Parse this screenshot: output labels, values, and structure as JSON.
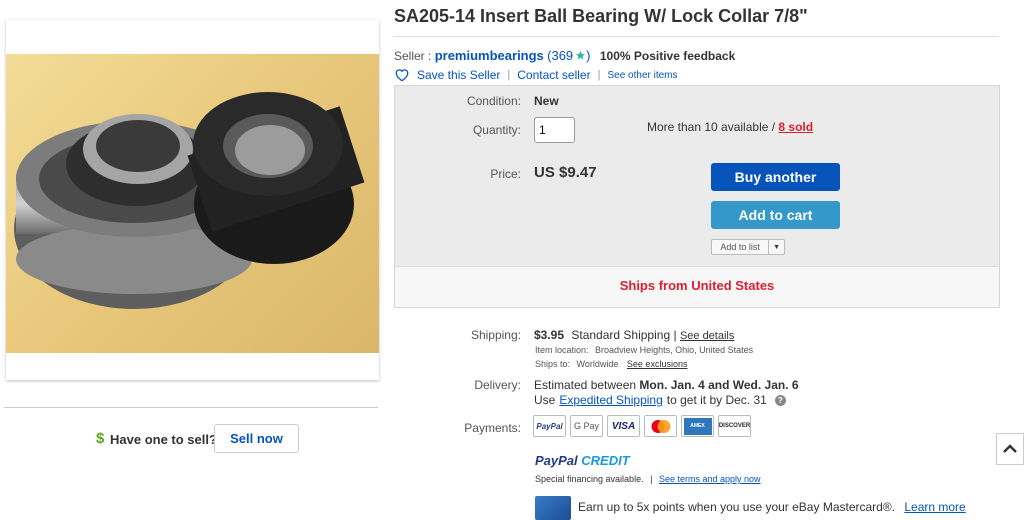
{
  "listing": {
    "title": "SA205-14 Insert Ball Bearing W/ Lock Collar 7/8\""
  },
  "seller": {
    "label": "Seller :",
    "name": "premiumbearings",
    "score_open": "(369",
    "score_close": ")",
    "feedback": "100% Positive feedback",
    "save_label": "Save this Seller",
    "contact_label": "Contact seller",
    "other_items_label": "See other items"
  },
  "purchase": {
    "condition_label": "Condition:",
    "condition_value": "New",
    "quantity_label": "Quantity:",
    "quantity_value": "1",
    "availability_text": "More than 10 available / ",
    "sold_text": "8 sold",
    "price_label": "Price:",
    "price_value": "US $9.47",
    "buy_label": "Buy another",
    "cart_label": "Add to cart",
    "add_list_label": "Add to list",
    "ships_from": "Ships from United States"
  },
  "shipping": {
    "label": "Shipping:",
    "cost": "$3.95",
    "method": "Standard Shipping",
    "details_link": "See details",
    "location_label": "Item location:",
    "location_value": "Broadview Heights, Ohio, United States",
    "ships_to_label": "Ships to:",
    "ships_to_value": "Worldwide",
    "exclusions_link": "See exclusions"
  },
  "delivery": {
    "label": "Delivery:",
    "prefix": "Estimated between",
    "range": "Mon. Jan. 4 and Wed. Jan. 6",
    "use": "Use",
    "expedited_link": "Expedited Shipping",
    "suffix": "to get it by Dec. 31"
  },
  "payments": {
    "label": "Payments:",
    "methods": [
      "PayPal",
      "G Pay",
      "VISA",
      "MasterCard",
      "AMEX",
      "DISCOVER"
    ],
    "paypal_credit_1": "PayPal",
    "paypal_credit_2": "CREDIT",
    "financing_text": "Special financing available.",
    "financing_link": "See terms and apply now",
    "mastercard_text": "Earn up to 5x points when you use your eBay Mastercard®.",
    "learn_more": "Learn more"
  },
  "sell": {
    "dollar": "$",
    "prompt": "Have one to sell?",
    "button": "Sell now"
  },
  "colors": {
    "link_blue": "#0654ba",
    "buy_button": "#0654ba",
    "cart_button": "#3498ca",
    "sold_red": "#dd1e31",
    "star_teal": "#2bb5a8"
  }
}
